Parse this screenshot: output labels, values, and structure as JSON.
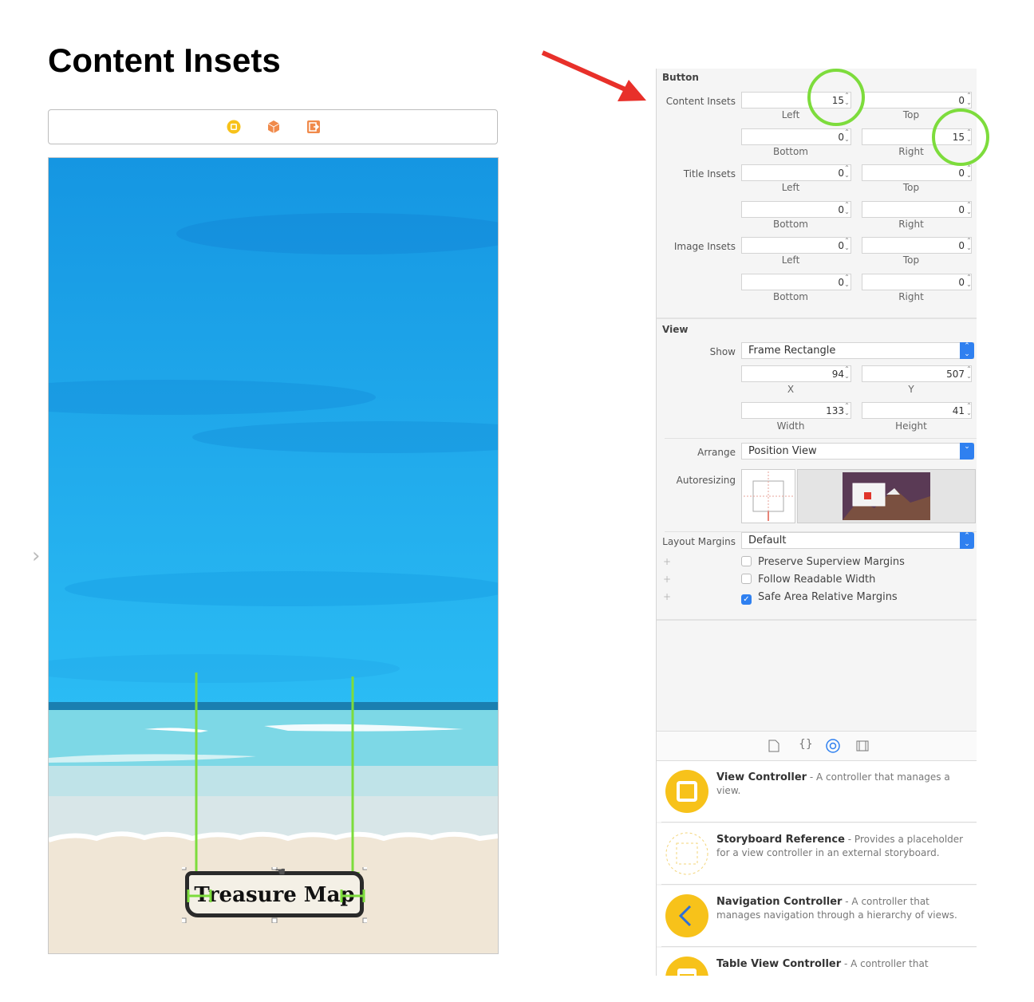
{
  "title": "Content Insets",
  "storyboard": {
    "button_label": "Treasure Map"
  },
  "inspector": {
    "button_section": {
      "title": "Button",
      "rows": [
        {
          "label": "Content Insets",
          "left": "15",
          "top": "0",
          "bottom": "0",
          "right": "15"
        },
        {
          "label": "Title Insets",
          "left": "0",
          "top": "0",
          "bottom": "0",
          "right": "0"
        },
        {
          "label": "Image Insets",
          "left": "0",
          "top": "0",
          "bottom": "0",
          "right": "0"
        }
      ],
      "sub_labels": {
        "left": "Left",
        "top": "Top",
        "bottom": "Bottom",
        "right": "Right"
      }
    },
    "view_section": {
      "title": "View",
      "show_label": "Show",
      "show_value": "Frame Rectangle",
      "x": "94",
      "y": "507",
      "width": "133",
      "height": "41",
      "x_label": "X",
      "y_label": "Y",
      "width_label": "Width",
      "height_label": "Height",
      "arrange_label": "Arrange",
      "arrange_value": "Position View",
      "autoresizing_label": "Autoresizing",
      "layout_margins_label": "Layout Margins",
      "layout_margins_value": "Default",
      "checks": [
        {
          "label": "Preserve Superview Margins",
          "checked": false
        },
        {
          "label": "Follow Readable Width",
          "checked": false
        },
        {
          "label": "Safe Area Relative Margins",
          "checked": true
        }
      ]
    },
    "library": [
      {
        "name": "View Controller",
        "desc": " - A controller that manages a view.",
        "icon": "view-controller-icon"
      },
      {
        "name": "Storyboard Reference",
        "desc": " - Provides a placeholder for a view controller in an external storyboard.",
        "icon": "storyboard-reference-icon"
      },
      {
        "name": "Navigation Controller",
        "desc": " - A controller that manages navigation through a hierarchy of views.",
        "icon": "navigation-controller-icon"
      },
      {
        "name": "Table View Controller",
        "desc": " - A controller that",
        "icon": "table-view-controller-icon"
      }
    ]
  },
  "colors": {
    "accent_arrow": "#e8302a",
    "highlight_green": "#7ddc3c",
    "sky": "#1ea7ec",
    "sand": "#f0e6d6",
    "xcode_blue": "#2f80f0"
  }
}
